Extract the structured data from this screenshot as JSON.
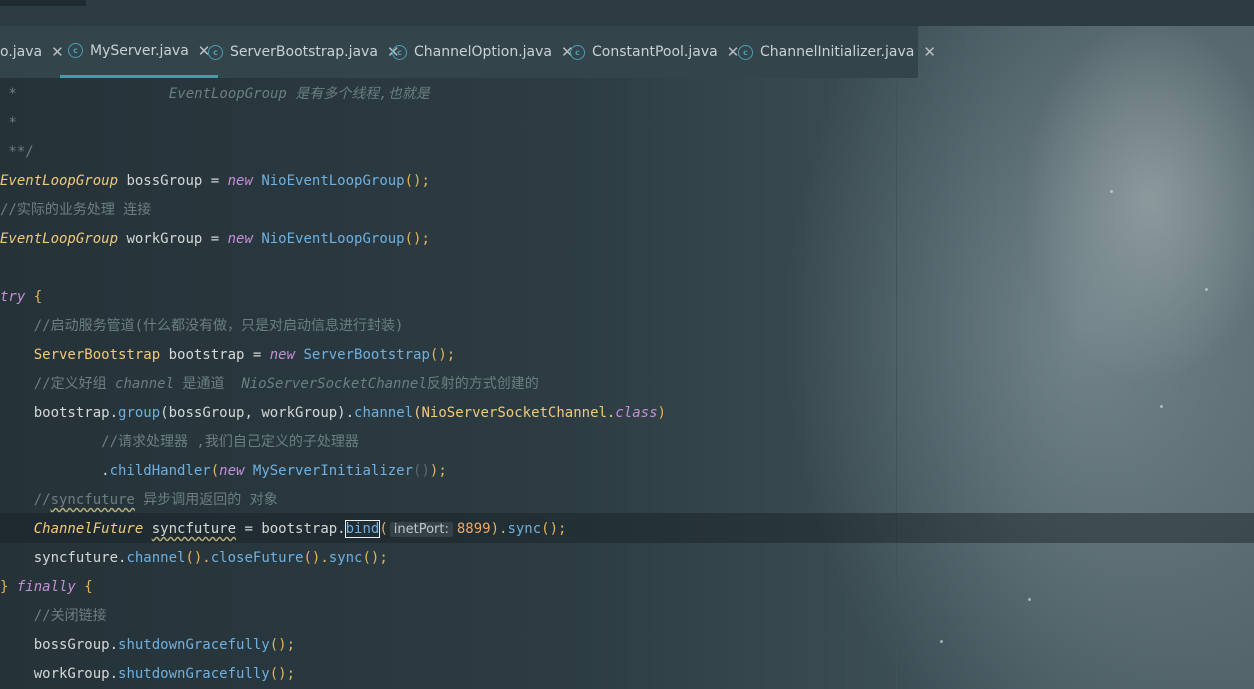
{
  "tabs": [
    {
      "label": "o.java",
      "icon": "none",
      "active": false
    },
    {
      "label": "MyServer.java",
      "icon": "class-icon",
      "active": true
    },
    {
      "label": "ServerBootstrap.java",
      "icon": "class-icon",
      "active": false
    },
    {
      "label": "ChannelOption.java",
      "icon": "class-icon",
      "active": false
    },
    {
      "label": "ConstantPool.java",
      "icon": "class-icon",
      "active": false
    },
    {
      "label": "ChannelInitializer.java",
      "icon": "class-icon",
      "active": false
    }
  ],
  "close_glyph": "✕",
  "editor": {
    "hint_label": "inetPort:",
    "lines": {
      "l1_star": " *",
      "l1_comment": "EventLoopGroup 是有多个线程,也就是",
      "l2": " *",
      "l3": " **/",
      "l4_type": "EventLoopGroup",
      "l4_var": " bossGroup = ",
      "l4_new": "new",
      "l4_ctor": " NioEventLoopGroup",
      "l4_end": "();",
      "l5": "//实际的业务处理 连接",
      "l6_type": "EventLoopGroup",
      "l6_var": " workGroup = ",
      "l6_new": "new",
      "l6_ctor": " NioEventLoopGroup",
      "l6_end": "();",
      "l7_try": "try",
      "l7_brace": " {",
      "l8": "    //启动服务管道(什么都没有做，只是对启动信息进行封装)",
      "l9_type": "    ServerBootstrap",
      "l9_var": " bootstrap = ",
      "l9_new": "new",
      "l9_ctor": " ServerBootstrap",
      "l9_end": "();",
      "l10_a": "    //定义好组 ",
      "l10_b": "channel",
      "l10_c": " 是通道  ",
      "l10_d": "NioServerSocketChannel",
      "l10_e": "反射的方式创建的",
      "l11_a": "    bootstrap.",
      "l11_fn1": "group",
      "l11_b": "(bossGroup, workGroup).",
      "l11_fn2": "channel",
      "l11_c": "(NioServerSocketChannel.",
      "l11_cls": "class",
      "l11_d": ")",
      "l12": "            //请求处理器 ,我们自己定义的子处理器",
      "l13_a": "            .",
      "l13_fn": "childHandler",
      "l13_b": "(",
      "l13_new": "new",
      "l13_c": " MyServerInitializer",
      "l13_d": "()",
      "l13_e": ");",
      "l14_a": "    //",
      "l14_b": "syncfuture",
      "l14_c": " 异步调用返回的 对象",
      "l15_type": "    ChannelFuture",
      "l15_sp": " ",
      "l15_var": "syncfuture",
      "l15_mid": " = bootstrap.",
      "l15_fn": "bind",
      "l15_paren": "(",
      "l15_num": "8899",
      "l15_b": ").",
      "l15_fn2": "sync",
      "l15_end": "();",
      "l16_a": "    syncfuture.",
      "l16_fn1": "channel",
      "l16_b": "().",
      "l16_fn2": "closeFuture",
      "l16_c": "().",
      "l16_fn3": "sync",
      "l16_d": "();",
      "l17_a": "} ",
      "l17_kw": "finally",
      "l17_b": " {",
      "l18": "    //关闭链接",
      "l19_a": "    bossGroup.",
      "l19_fn": "shutdownGracefully",
      "l19_b": "();",
      "l20_a": "    workGroup.",
      "l20_fn": "shutdownGracefully",
      "l20_b": "();"
    }
  }
}
